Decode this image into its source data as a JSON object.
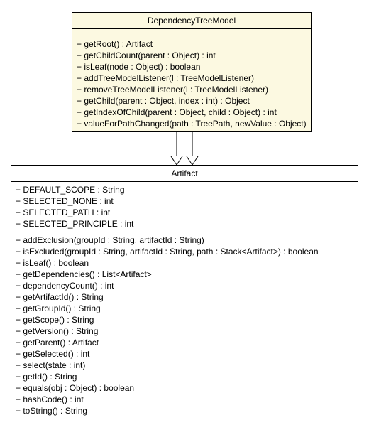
{
  "classes": {
    "dependencyTreeModel": {
      "name": "DependencyTreeModel",
      "methods": [
        "+ getRoot() : Artifact",
        "+ getChildCount(parent : Object) : int",
        "+ isLeaf(node : Object) : boolean",
        "+ addTreeModelListener(l : TreeModelListener)",
        "+ removeTreeModelListener(l : TreeModelListener)",
        "+ getChild(parent : Object, index : int) : Object",
        "+ getIndexOfChild(parent : Object, child : Object) : int",
        "+ valueForPathChanged(path : TreePath, newValue : Object)"
      ]
    },
    "artifact": {
      "name": "Artifact",
      "fields": [
        "+ DEFAULT_SCOPE : String",
        "+ SELECTED_NONE : int",
        "+ SELECTED_PATH : int",
        "+ SELECTED_PRINCIPLE : int"
      ],
      "methods": [
        "+ addExclusion(groupId : String, artifactId : String)",
        "+ isExcluded(groupId : String, artifactId : String, path : Stack<Artifact>) : boolean",
        "+ isLeaf() : boolean",
        "+ getDependencies() : List<Artifact>",
        "+ dependencyCount() : int",
        "+ getArtifactId() : String",
        "+ getGroupId() : String",
        "+ getScope() : String",
        "+ getVersion() : String",
        "+ getParent() : Artifact",
        "+ getSelected() : int",
        "+ select(state : int)",
        "+ getId() : String",
        "+ equals(obj : Object) : boolean",
        "+ hashCode() : int",
        "+ toString() : String"
      ]
    }
  },
  "chart_data": {
    "type": "diagram",
    "diagram_type": "uml_class",
    "classes": [
      {
        "name": "DependencyTreeModel",
        "stereotype": null,
        "fields": 0,
        "methods": 8
      },
      {
        "name": "Artifact",
        "stereotype": null,
        "fields": 4,
        "methods": 16
      }
    ],
    "relations": [
      {
        "from": "DependencyTreeModel",
        "to": "Artifact",
        "type": "dependency",
        "multiplicity": 2
      }
    ]
  }
}
